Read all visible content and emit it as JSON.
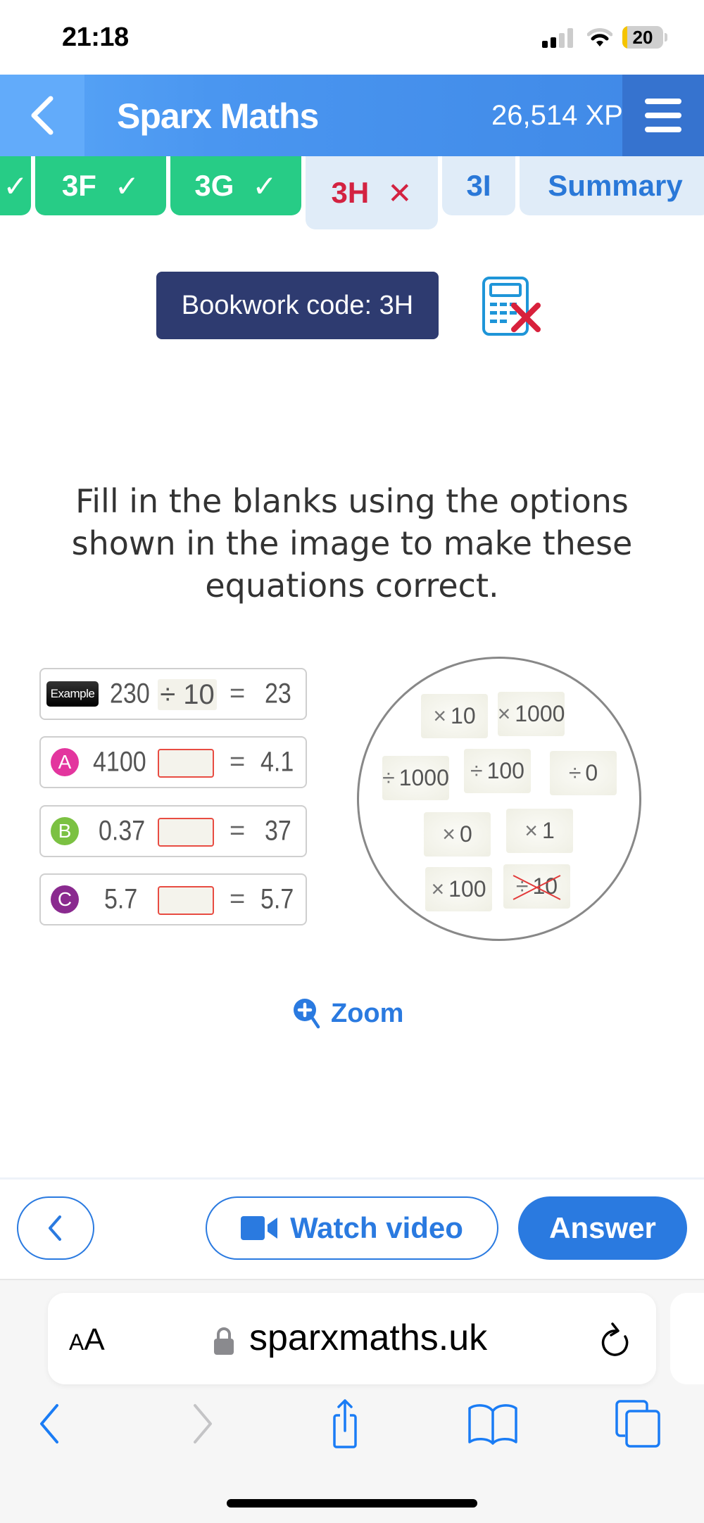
{
  "status_bar": {
    "time": "21:18",
    "battery": "20",
    "signal_bars_active": 2,
    "signal_bars_total": 4
  },
  "header": {
    "back_icon": "chevron-left-icon",
    "title": "Sparx Maths",
    "xp": "26,514 XP",
    "menu_icon": "hamburger-menu-icon"
  },
  "tabs": [
    {
      "label": "",
      "mark": "✓",
      "state": "done"
    },
    {
      "label": "3F",
      "mark": "✓",
      "state": "done"
    },
    {
      "label": "3G",
      "mark": "✓",
      "state": "done"
    },
    {
      "label": "3H",
      "mark": "✕",
      "state": "current"
    },
    {
      "label": "3I",
      "mark": "",
      "state": "todo"
    },
    {
      "label": "Summary",
      "mark": "",
      "state": "todo"
    }
  ],
  "bookwork": {
    "label": "Bookwork code: 3H",
    "calculator_icon": "calculator-not-allowed-icon"
  },
  "question": {
    "text": "Fill in the blanks using the options shown in the image to make these equations correct."
  },
  "equations": {
    "example": {
      "badge": "Example",
      "lhs": "230",
      "op": "÷ 10",
      "equals": "=",
      "rhs": "23"
    },
    "items": [
      {
        "badge": "A",
        "color": "#e3359e",
        "lhs": "4100",
        "equals": "=",
        "rhs": "4.1"
      },
      {
        "badge": "B",
        "color": "#7bc142",
        "lhs": "0.37",
        "equals": "=",
        "rhs": "37"
      },
      {
        "badge": "C",
        "color": "#8a2a8f",
        "lhs": "5.7",
        "equals": "=",
        "rhs": "5.7"
      }
    ]
  },
  "options": [
    {
      "sym": "×",
      "val": "10",
      "crossed": false
    },
    {
      "sym": "×",
      "val": "1000",
      "crossed": false
    },
    {
      "sym": "÷",
      "val": "1000",
      "crossed": false
    },
    {
      "sym": "÷",
      "val": "100",
      "crossed": false
    },
    {
      "sym": "÷",
      "val": "0",
      "crossed": false
    },
    {
      "sym": "×",
      "val": "0",
      "crossed": false
    },
    {
      "sym": "×",
      "val": "1",
      "crossed": false
    },
    {
      "sym": "×",
      "val": "100",
      "crossed": false
    },
    {
      "sym": "÷",
      "val": "10",
      "crossed": true
    }
  ],
  "zoom": {
    "label": "Zoom",
    "icon": "zoom-in-icon"
  },
  "actions": {
    "back_icon": "chevron-left-icon",
    "watch_video": "Watch video",
    "video_icon": "video-camera-icon",
    "answer": "Answer"
  },
  "browser": {
    "text_size": "AA",
    "url": "sparxmaths.uk",
    "lock_icon": "lock-icon",
    "reload_icon": "reload-icon",
    "toolbar": [
      "back-icon",
      "forward-icon",
      "share-icon",
      "bookmarks-icon",
      "tabs-icon"
    ]
  },
  "colors": {
    "brand_blue": "#2a7ae0",
    "done_green": "#27cc86",
    "wrong_red": "#d32241",
    "bookwork_navy": "#2e3b70"
  }
}
